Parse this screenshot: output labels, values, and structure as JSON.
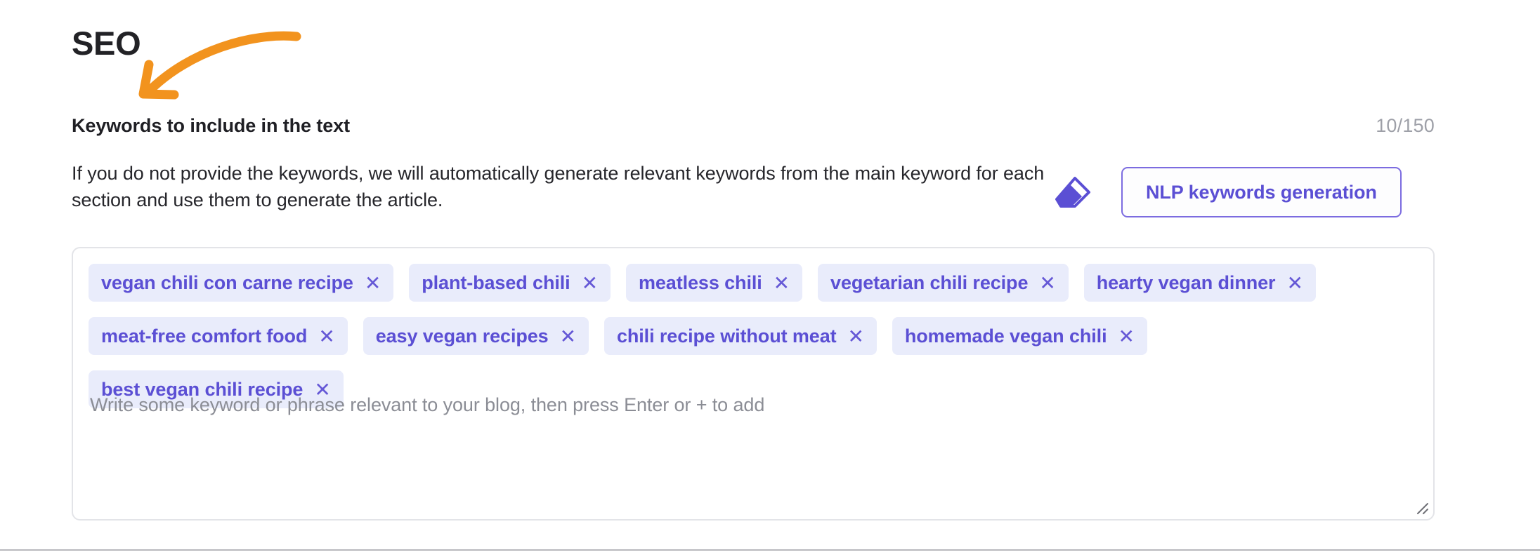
{
  "section": {
    "title": "SEO"
  },
  "keywords_field": {
    "label": "Keywords to include in the text",
    "counter": "10/150",
    "description": "If you do not provide the keywords, we will automatically generate relevant keywords from the main keyword for each section and use them to generate the article.",
    "placeholder": "Write some keyword or phrase relevant to your blog, then press Enter or + to add",
    "remove_glyph": "✕",
    "chips": [
      "vegan chili con carne recipe",
      "plant-based chili",
      "meatless chili",
      "vegetarian chili recipe",
      "hearty vegan dinner",
      "meat-free comfort food",
      "easy vegan recipes",
      "chili recipe without meat",
      "homemade vegan chili",
      "best vegan chili recipe"
    ]
  },
  "actions": {
    "eraser_icon": "eraser-icon",
    "nlp_button_label": "NLP keywords generation"
  },
  "annotation": {
    "arrow_icon": "curved-arrow-icon",
    "arrow_color": "#f2931e"
  },
  "colors": {
    "accent_purple": "#5b4fd4",
    "chip_background": "#e9ecfb",
    "counter_gray": "#9ea0a8",
    "border_gray": "#e3e4e8",
    "annotation_orange": "#f2931e"
  }
}
